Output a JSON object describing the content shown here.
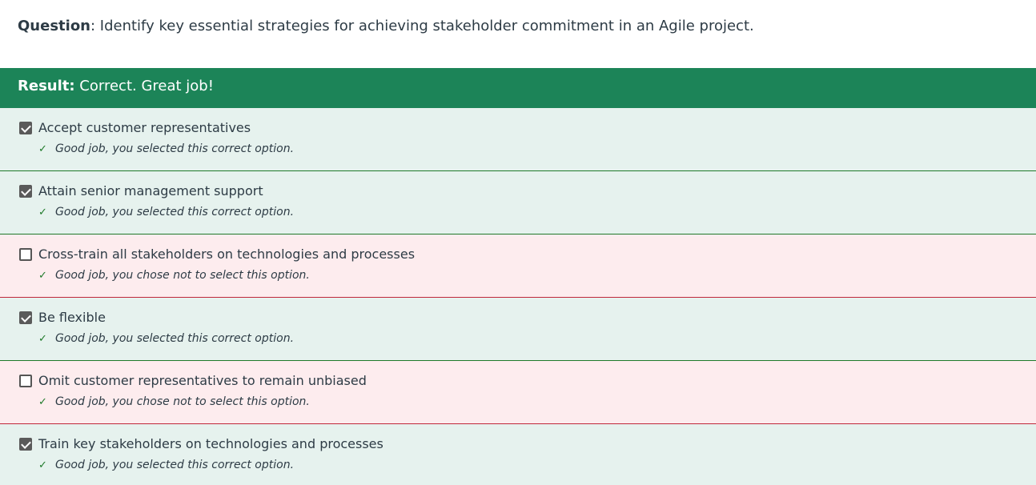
{
  "question": {
    "label": "Question",
    "text": ": Identify key essential strategies for achieving stakeholder commitment in an Agile project."
  },
  "result": {
    "label": "Result:",
    "text": " Correct. Great job!"
  },
  "colors": {
    "result_bar": "#1c8458",
    "correct_bg": "#e6f2ee",
    "incorrect_bg": "#fdecee",
    "correct_border": "#1f7a2a",
    "incorrect_border": "#c0283a"
  },
  "options": [
    {
      "label": "Accept customer representatives",
      "checked": true,
      "status": "correct",
      "feedback": "Good job, you selected this correct option.",
      "feedback_icon": "checkmark-icon"
    },
    {
      "label": "Attain senior management support",
      "checked": true,
      "status": "correct",
      "feedback": "Good job, you selected this correct option.",
      "feedback_icon": "checkmark-icon"
    },
    {
      "label": "Cross-train all stakeholders on technologies and processes",
      "checked": false,
      "status": "incorrect",
      "feedback": "Good job, you chose not to select this option.",
      "feedback_icon": "checkmark-icon"
    },
    {
      "label": "Be flexible",
      "checked": true,
      "status": "correct",
      "feedback": "Good job, you selected this correct option.",
      "feedback_icon": "checkmark-icon"
    },
    {
      "label": "Omit customer representatives to remain unbiased",
      "checked": false,
      "status": "incorrect",
      "feedback": "Good job, you chose not to select this option.",
      "feedback_icon": "checkmark-icon"
    },
    {
      "label": "Train key stakeholders on technologies and processes",
      "checked": true,
      "status": "correct",
      "feedback": "Good job, you selected this correct option.",
      "feedback_icon": "checkmark-icon"
    }
  ]
}
